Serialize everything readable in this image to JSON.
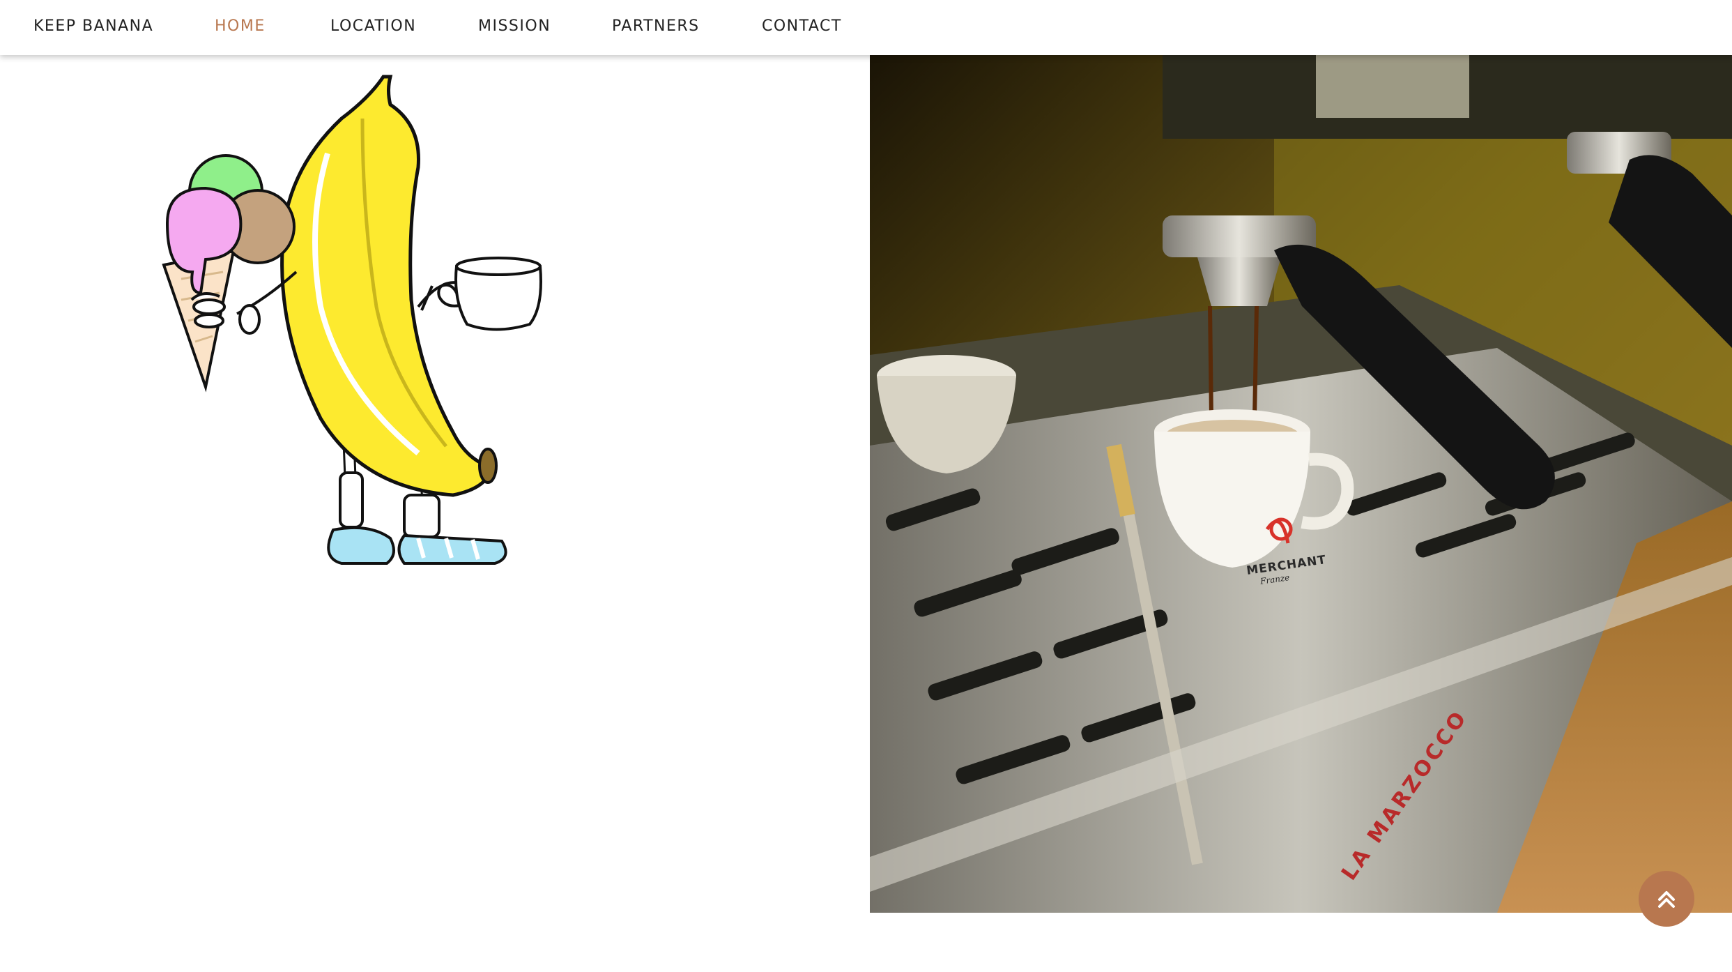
{
  "nav": {
    "brand": "KEEP BANANA",
    "items": [
      {
        "label": "HOME",
        "active": true
      },
      {
        "label": "LOCATION",
        "active": false
      },
      {
        "label": "MISSION",
        "active": false
      },
      {
        "label": "PARTNERS",
        "active": false
      },
      {
        "label": "CONTACT",
        "active": false
      }
    ]
  },
  "photo": {
    "cup_brand": "MERCHANT",
    "cup_subtext": "Franze",
    "machine_brand": "LA MARZOCCO"
  },
  "scroll_top": {
    "icon": "double-chevron-up-icon"
  },
  "colors": {
    "accent": "#b8774f",
    "nav_text": "#222222",
    "banana": "#fdea2f"
  }
}
